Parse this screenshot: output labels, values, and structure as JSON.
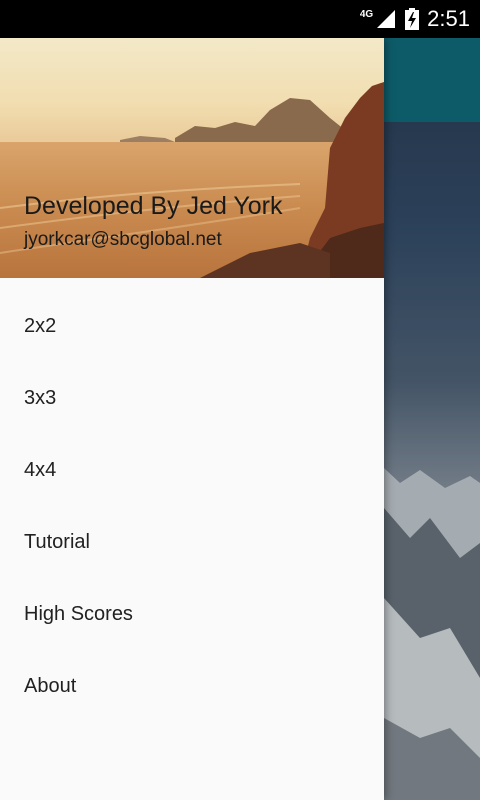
{
  "status_bar": {
    "network": "4G",
    "time": "2:51",
    "icons": [
      "signal-icon",
      "battery-charging-icon"
    ]
  },
  "drawer": {
    "header": {
      "title": "Developed By Jed York",
      "subtitle": "jyorkcar@sbcglobal.net"
    },
    "menu": [
      {
        "label": "2x2"
      },
      {
        "label": "3x3"
      },
      {
        "label": "4x4"
      },
      {
        "label": "Tutorial"
      },
      {
        "label": "High Scores"
      },
      {
        "label": "About"
      }
    ]
  },
  "colors": {
    "toolbar": "#10707f",
    "drawer_background": "#fafafa",
    "status_bar": "#000000",
    "menu_text": "#212121"
  }
}
